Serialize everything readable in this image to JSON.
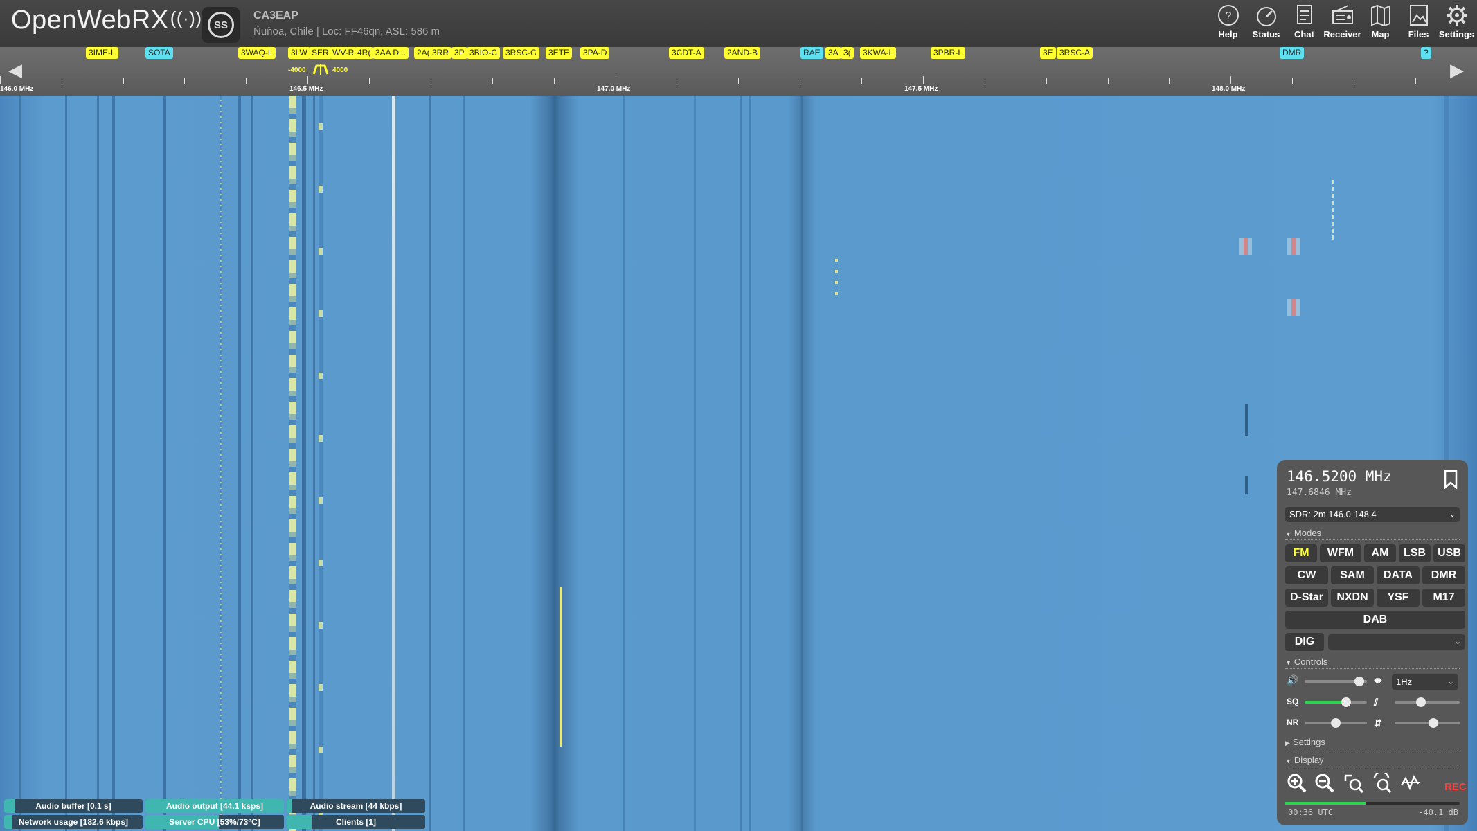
{
  "header": {
    "logo_text": "OpenWebRX",
    "avatar_text": "SS",
    "receiver_name": "CA3EAP",
    "receiver_desc": "Ñuñoa, Chile | Loc: FF46qn, ASL: 586 m",
    "nav": [
      {
        "label": "Help",
        "icon": "help-icon"
      },
      {
        "label": "Status",
        "icon": "status-gauge-icon"
      },
      {
        "label": "Chat",
        "icon": "chat-icon"
      },
      {
        "label": "Receiver",
        "icon": "receiver-icon"
      },
      {
        "label": "Map",
        "icon": "map-icon"
      },
      {
        "label": "Files",
        "icon": "files-icon"
      },
      {
        "label": "Settings",
        "icon": "gear-icon"
      }
    ]
  },
  "scale": {
    "ticks": [
      "146.0 MHz",
      "146.5 MHz",
      "147.0 MHz",
      "147.5 MHz",
      "148.0 MHz"
    ],
    "filter_low": "-4000",
    "filter_high": "4000",
    "bookmarks": [
      {
        "label": "3IME-L",
        "color": "yellow"
      },
      {
        "label": "SOTA",
        "color": "cyan"
      },
      {
        "label": "3WAQ-L",
        "color": "yellow"
      },
      {
        "label": "3LW",
        "color": "yellow"
      },
      {
        "label": "SER",
        "color": "yellow"
      },
      {
        "label": "WV-R",
        "color": "yellow"
      },
      {
        "label": "4R(",
        "color": "yellow"
      },
      {
        "label": "3AA D...",
        "color": "yellow"
      },
      {
        "label": "2A(",
        "color": "yellow"
      },
      {
        "label": "3RR",
        "color": "yellow"
      },
      {
        "label": "3P",
        "color": "yellow"
      },
      {
        "label": "3BIO-C",
        "color": "yellow"
      },
      {
        "label": "3RSC-C",
        "color": "yellow"
      },
      {
        "label": "3ETE",
        "color": "yellow"
      },
      {
        "label": "3PA-D",
        "color": "yellow"
      },
      {
        "label": "3CDT-A",
        "color": "yellow"
      },
      {
        "label": "2AND-B",
        "color": "yellow"
      },
      {
        "label": "RAE",
        "color": "cyan"
      },
      {
        "label": "3A",
        "color": "yellow"
      },
      {
        "label": "3(",
        "color": "yellow"
      },
      {
        "label": "3KWA-L",
        "color": "yellow"
      },
      {
        "label": "3PBR-L",
        "color": "yellow"
      },
      {
        "label": "3E",
        "color": "yellow"
      },
      {
        "label": "3RSC-A",
        "color": "yellow"
      },
      {
        "label": "DMR",
        "color": "cyan"
      },
      {
        "label": "?",
        "color": "cyan"
      }
    ]
  },
  "status": {
    "audio_buffer": "Audio buffer [0.1 s]",
    "audio_output": "Audio output [44.1 ksps]",
    "audio_stream": "Audio stream [44 kbps]",
    "network_usage": "Network usage [182.6 kbps]",
    "server_cpu": "Server CPU [53%/73°C]",
    "clients": "Clients [1]"
  },
  "panel": {
    "frequency": "146.5200 MHz",
    "sub_frequency": "147.6846 MHz",
    "sdr_profile": "SDR: 2m 146.0-148.4",
    "modes_title": "Modes",
    "modes": [
      "FM",
      "WFM",
      "AM",
      "LSB",
      "USB",
      "CW",
      "SAM",
      "DATA",
      "DMR",
      "D-Star",
      "NXDN",
      "YSF",
      "M17",
      "DAB"
    ],
    "active_mode": "FM",
    "dig_label": "DIG",
    "dig_value": "",
    "controls_title": "Controls",
    "step_value": "1Hz",
    "sq_label": "SQ",
    "nr_label": "NR",
    "volume_level": 0.88,
    "squelch_level": 0.67,
    "nr_level": 0.5,
    "slider_right_1": 0.4,
    "slider_right_2": 0.6,
    "settings_title": "Settings",
    "display_title": "Display",
    "rec_label": "REC",
    "clock": "00:36 UTC",
    "level_db": "-40.1 dB",
    "level_fill": 0.46,
    "accent": "#ffff33",
    "green": "#27d84a"
  }
}
